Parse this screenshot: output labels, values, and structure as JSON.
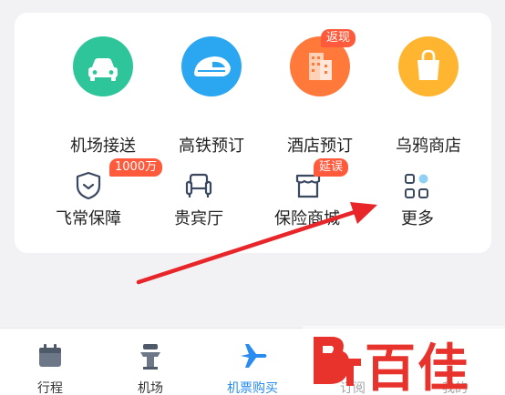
{
  "services": [
    {
      "label": "机场接送",
      "icon": "car-icon",
      "color": "#2fc59a"
    },
    {
      "label": "高铁预订",
      "icon": "train-icon",
      "color": "#2ba6f0"
    },
    {
      "label": "酒店预订",
      "icon": "building-icon",
      "color": "#ff7a3a",
      "badge": "返现"
    },
    {
      "label": "乌鸦商店",
      "icon": "shopping-bag-icon",
      "color": "#ffb530"
    },
    {
      "label": "飞常保障",
      "icon": "shield-icon",
      "badge": "1000万"
    },
    {
      "label": "贵宾厅",
      "icon": "sofa-icon"
    },
    {
      "label": "保险商城",
      "icon": "store-icon",
      "badge": "延误"
    },
    {
      "label": "更多",
      "icon": "grid-more-icon"
    }
  ],
  "tabbar": {
    "items": [
      {
        "label": "行程",
        "icon": "calendar-icon"
      },
      {
        "label": "机场",
        "icon": "control-tower-icon"
      },
      {
        "label": "机票购买",
        "icon": "airplane-icon",
        "active": true
      },
      {
        "label": "订阅",
        "icon": "subscribe-icon"
      },
      {
        "label": "我的",
        "icon": "profile-icon"
      }
    ]
  },
  "watermark": {
    "text": "百佳"
  },
  "colors": {
    "accent": "#2a8cf0",
    "badge": "#ff5a3c",
    "arrow": "#e8262a"
  }
}
